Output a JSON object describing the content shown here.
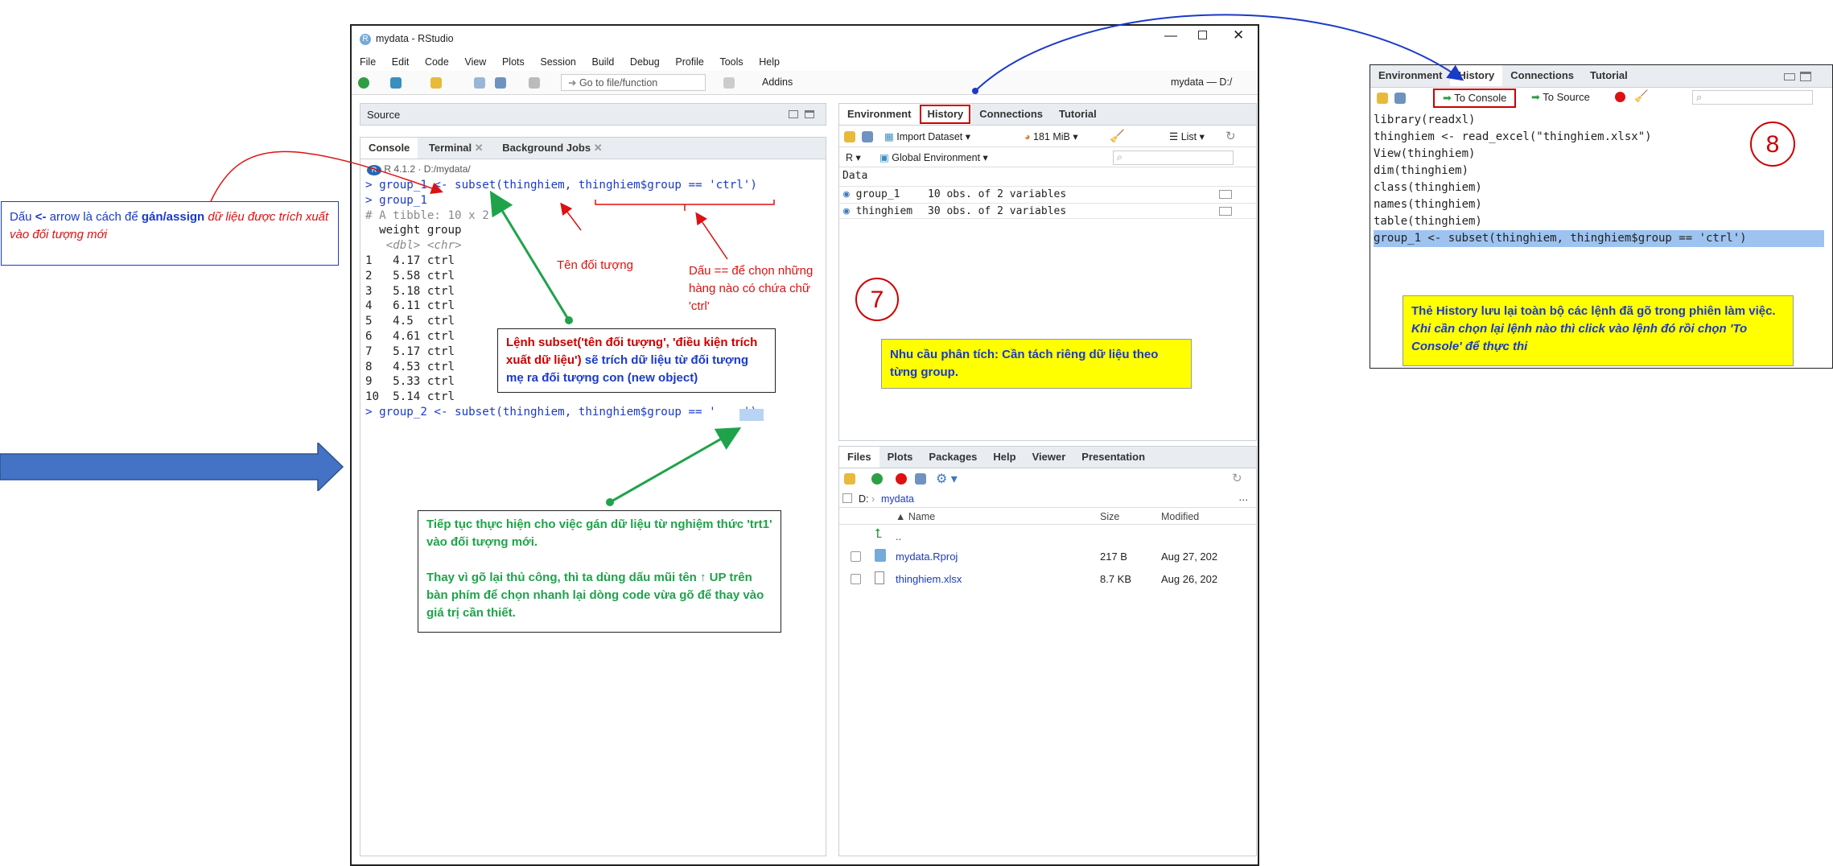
{
  "window": {
    "title": "mydata - RStudio",
    "menu": [
      "File",
      "Edit",
      "Code",
      "View",
      "Plots",
      "Session",
      "Build",
      "Debug",
      "Profile",
      "Tools",
      "Help"
    ],
    "toolbar": {
      "goto_placeholder": "Go to file/function",
      "addins": "Addins",
      "project": "mydata — D:/"
    }
  },
  "source_pane": {
    "title": "Source"
  },
  "console_pane": {
    "tabs": [
      "Console",
      "Terminal",
      "Background Jobs"
    ],
    "status": "R 4.1.2 · D:/mydata/",
    "lines": [
      "> group_1 <- subset(thinghiem, thinghiem$group == 'ctrl')",
      "> group_1",
      "# A tibble: 10 x 2",
      "  weight group",
      "   <dbl> <chr>",
      "1   4.17 ctrl",
      "2   5.58 ctrl",
      "3   5.18 ctrl",
      "4   6.11 ctrl",
      "5   4.5  ctrl",
      "6   4.61 ctrl",
      "7   5.17 ctrl",
      "8   4.53 ctrl",
      "9   5.33 ctrl",
      "10  5.14 ctrl",
      "> group_2 <- subset(thinghiem, thinghiem$group == '    ')"
    ]
  },
  "env_pane": {
    "tabs": [
      "Environment",
      "History",
      "Connections",
      "Tutorial"
    ],
    "import_label": "Import Dataset",
    "memory": "181 MiB",
    "view": "List",
    "lang": "R",
    "scope": "Global Environment",
    "section": "Data",
    "rows": [
      {
        "name": "group_1",
        "value": "10 obs. of 2 variables"
      },
      {
        "name": "thinghiem",
        "value": "30 obs. of 2 variables"
      }
    ]
  },
  "files_pane": {
    "tabs": [
      "Files",
      "Plots",
      "Packages",
      "Help",
      "Viewer",
      "Presentation"
    ],
    "path_root": "D:",
    "path_dir": "mydata",
    "cols": [
      "▲ Name",
      "Size",
      "Modified"
    ],
    "rows": [
      {
        "name": "..",
        "size": "",
        "modified": ""
      },
      {
        "name": "mydata.Rproj",
        "size": "217 B",
        "modified": "Aug 27, 202"
      },
      {
        "name": "thinghiem.xlsx",
        "size": "8.7 KB",
        "modified": "Aug 26, 202"
      }
    ]
  },
  "history_panel": {
    "tabs": [
      "Environment",
      "History",
      "Connections",
      "Tutorial"
    ],
    "to_console": "To Console",
    "to_source": "To Source",
    "lines": [
      "library(readxl)",
      "thinghiem <- read_excel(\"thinghiem.xlsx\")",
      "View(thinghiem)",
      "dim(thinghiem)",
      "class(thinghiem)",
      "names(thinghiem)",
      "table(thinghiem)",
      "group_1 <- subset(thinghiem, thinghiem$group == 'ctrl')"
    ]
  },
  "annotations": {
    "assign_prefix": "Dấu ",
    "assign_op": "<-",
    "assign_mid": " arrow là cách để ",
    "assign_bold": "gán/assign",
    "assign_tail": " dữ liệu được trích xuất vào đối tượng mới",
    "object_name": "Tên đối tượng",
    "equals_note": "Dấu == để chọn những hàng nào có chứa chữ 'ctrl'",
    "subset_red": "Lệnh subset('tên đối tượng', 'điều kiện trích xuất dữ liệu')",
    "subset_blue": " sẽ trích dữ liệu từ đối tượng mẹ ra đối tượng con (new object)",
    "green_1": "Tiếp tục thực hiện cho việc gán dữ liệu từ nghiệm thức 'trt1' vào đối tượng mới.",
    "green_2": "Thay vì gõ lại thủ công, thì ta dùng dấu mũi tên ↑ UP trên bàn phím để chọn nhanh lại dòng code vừa gõ để thay vào giá trị cần thiết.",
    "analysis_note": "Nhu cầu phân tích: Cần tách riêng dữ liệu theo từng group.",
    "history_note_1": "Thẻ History lưu lại toàn bộ các lệnh đã gõ trong phiên làm việc.",
    "history_note_2": "Khi cần chọn lại lệnh nào thì click vào lệnh đó rồi chọn 'To Console' để thực thi",
    "num7": "7",
    "num8": "8"
  },
  "colors": {
    "red": "#d11",
    "blue": "#1a3ac8",
    "green": "#1ea34a",
    "yellow": "#ffff00",
    "arrow_fill": "#4472c4"
  }
}
